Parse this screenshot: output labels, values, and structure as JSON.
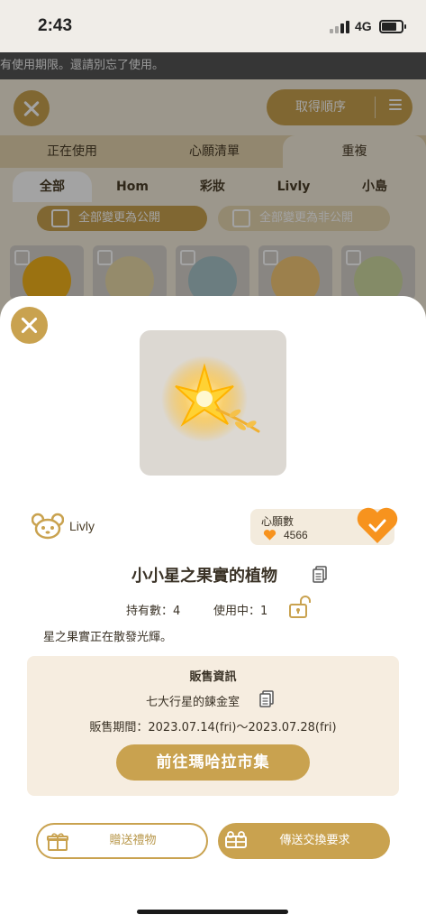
{
  "status_bar": {
    "time": "2:43",
    "network": "4G"
  },
  "notice": {
    "text": "有使用期限。還請別忘了使用。"
  },
  "background": {
    "sort_label": "取得順序",
    "tabs": [
      "正在使用",
      "心願清單",
      "重複"
    ],
    "categories": [
      "全部",
      "Hom",
      "彩妝",
      "Livly",
      "小島"
    ],
    "public_all": "全部變更為公開",
    "private_all": "全部變更為非公開"
  },
  "item": {
    "brand": "Livly",
    "wish_title": "心願數",
    "wish_count": "4566",
    "name": "小小星之果實的植物",
    "owned": "持有數：4",
    "in_use": "使用中：1",
    "description": "星之果實正在散發光輝。"
  },
  "sale": {
    "title": "販售資訊",
    "shop": "七大行星的鍊金室",
    "period": "販售期間：2023.07.14(fri)～2023.07.28(fri)",
    "go_label": "前往瑪哈拉市集"
  },
  "actions": {
    "gift_label": "贈送禮物",
    "trade_label": "傳送交換要求"
  },
  "colors": {
    "accent": "#c9a24f",
    "heart": "#f7931e"
  }
}
